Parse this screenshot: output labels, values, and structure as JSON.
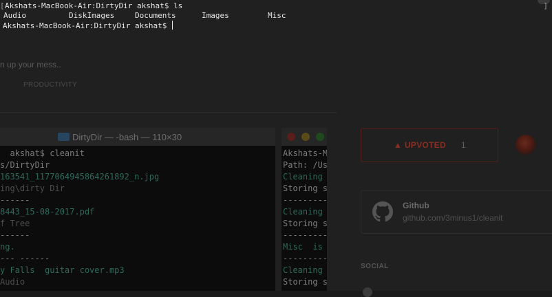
{
  "terminal": {
    "prompt_line_1": "Akshats-MacBook-Air:DirtyDir akshat$ ls",
    "ls_output": [
      "Audio",
      "DiskImages",
      "Documents",
      "Images",
      "Misc"
    ],
    "prompt_line_2": "Akshats-MacBook-Air:DirtyDir akshat$ ",
    "bracket_left": "[",
    "bracket_right": "]"
  },
  "page": {
    "tagline": "n up your mess..",
    "tag": "PRODUCTIVITY",
    "window1": {
      "title": "DirtyDir — -bash — 110×30",
      "lines": [
        {
          "text": "  akshat$ cleanit",
          "cls": "w"
        },
        {
          "text": "s/DirtyDir",
          "cls": "w"
        },
        {
          "text": "163541_1177064945864261892_n.jpg",
          "cls": "g"
        },
        {
          "text": "ing\\dirty Dir",
          "cls": "dim"
        },
        {
          "text": "------",
          "cls": "w"
        },
        {
          "text": "8443_15-08-2017.pdf",
          "cls": "g"
        },
        {
          "text": "f Tree",
          "cls": "dim"
        },
        {
          "text": "------",
          "cls": "w"
        },
        {
          "text": "ng.",
          "cls": "g"
        },
        {
          "text": "--- ------",
          "cls": "w"
        },
        {
          "text": "y Falls  guitar cover.mp3",
          "cls": "g"
        },
        {
          "text": "Audio",
          "cls": "dim"
        }
      ]
    },
    "window2": {
      "title": "",
      "lines": [
        {
          "text": "Akshats-M",
          "cls": "w"
        },
        {
          "text": "Path: /Us",
          "cls": "w"
        },
        {
          "text": "Cleaning",
          "cls": "g"
        },
        {
          "text": "Storing s",
          "cls": "w"
        },
        {
          "text": "---------",
          "cls": "w"
        },
        {
          "text": "Cleaning",
          "cls": "g"
        },
        {
          "text": "Storing s",
          "cls": "w"
        },
        {
          "text": "---------",
          "cls": "w"
        },
        {
          "text": "Misc  is ",
          "cls": "g"
        },
        {
          "text": "---------",
          "cls": "w"
        },
        {
          "text": "Cleaning",
          "cls": "g"
        },
        {
          "text": "Storing s",
          "cls": "w"
        }
      ]
    },
    "upvote": {
      "arrow": "▲",
      "label": "UPVOTED",
      "count": "1"
    },
    "github": {
      "title": "Github",
      "url": "github.com/3minus1/cleanit"
    },
    "social_heading": "SOCIAL"
  },
  "colors": {
    "accent": "#8a2e22",
    "terminal_text": "#e6e6e6",
    "green_text": "#2d6a5a"
  }
}
